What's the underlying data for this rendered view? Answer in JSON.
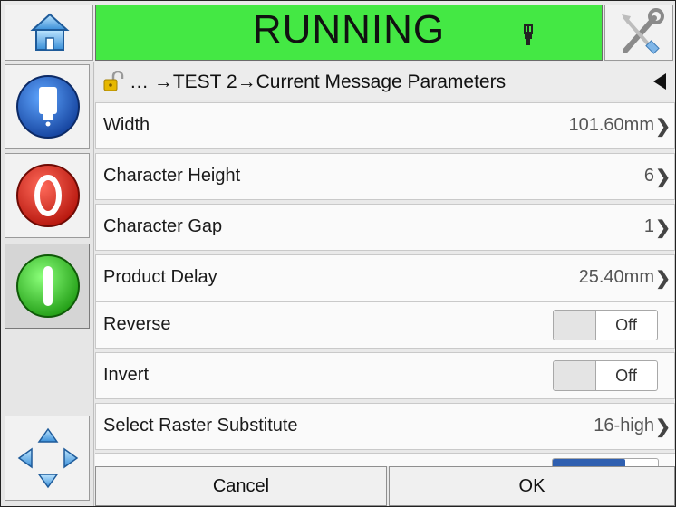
{
  "status": {
    "text": "RUNNING",
    "color": "#44e844"
  },
  "icons": {
    "home": "home-icon",
    "ink": "ink-cartridge-icon",
    "tools": "tools-icon",
    "printer_status": "printer-status-icon",
    "stop": "stop-icon",
    "start": "start-icon",
    "navigate": "navigation-arrows-icon",
    "lock": "unlocked-padlock-icon",
    "back": "back-arrow-icon"
  },
  "breadcrumb": {
    "text": "… →TEST 2→Current Message Parameters"
  },
  "rows": [
    {
      "label": "Width",
      "value": "101.60mm"
    },
    {
      "label": "Character Height",
      "value": "6"
    },
    {
      "label": "Character Gap",
      "value": "1"
    },
    {
      "label": "Product Delay",
      "value": "25.40mm"
    },
    {
      "label": "Reverse",
      "toggle": "Off"
    },
    {
      "label": "Invert",
      "toggle": "Off"
    },
    {
      "label": "Select Raster Substitute",
      "value": "16-high"
    }
  ],
  "buttons": {
    "cancel": "Cancel",
    "ok": "OK"
  }
}
